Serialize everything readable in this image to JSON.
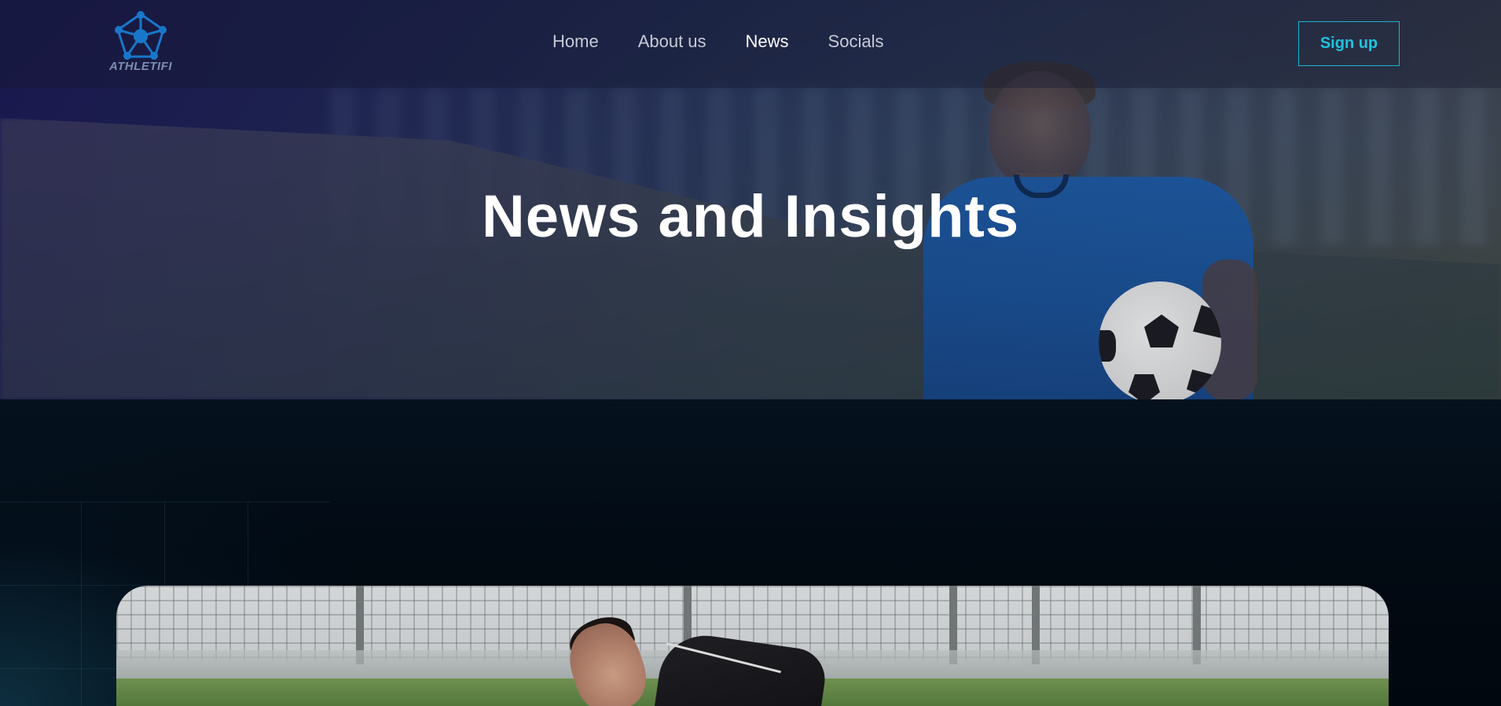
{
  "brand": {
    "logo_text": "ATHLETIFI",
    "accent_color": "#1fc3e0",
    "logo_color": "#1877c9"
  },
  "nav": {
    "links": [
      {
        "label": "Home",
        "active": false
      },
      {
        "label": "About us",
        "active": false
      },
      {
        "label": "News",
        "active": true
      },
      {
        "label": "Socials",
        "active": false
      }
    ],
    "signup_label": "Sign up"
  },
  "hero": {
    "title": "News and Insights",
    "image": "boy-in-blue-jersey-holding-soccer-ball"
  },
  "news_card": {
    "image": "man-stretching-on-soccer-field"
  },
  "icons": {
    "logo": "pentagon-network-logo"
  }
}
